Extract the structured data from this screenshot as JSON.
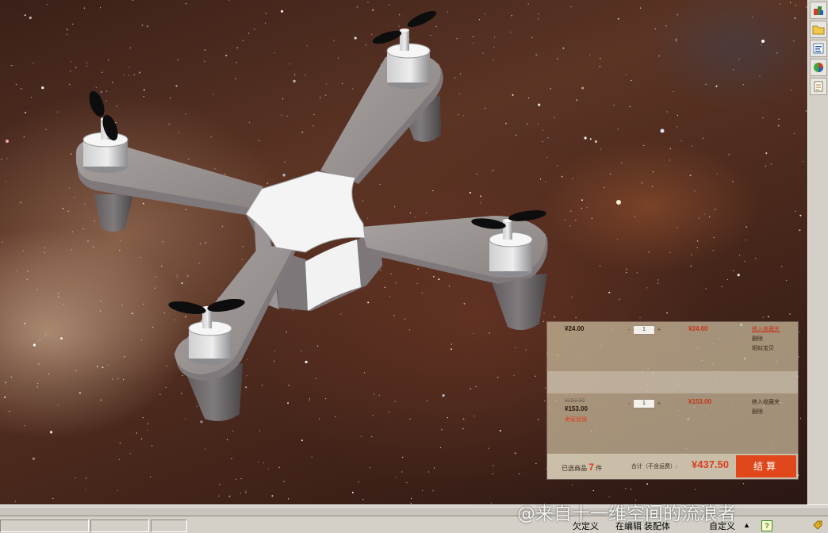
{
  "cart": {
    "items": [
      {
        "unit_price": "¥24.00",
        "quantity": "1",
        "subtotal": "¥24.00",
        "actions": [
          "移入收藏夹",
          "删除",
          "相似宝贝"
        ]
      },
      {
        "original_price": "¥153.00",
        "unit_price": "¥153.00",
        "quantity": "1",
        "subtotal": "¥153.00",
        "promo": "卖家促销",
        "actions": [
          "移入收藏夹",
          "删除"
        ]
      }
    ],
    "qty_minus": "-",
    "qty_plus": "+",
    "footer": {
      "selected_prefix": "已选商品",
      "selected_count": "7",
      "selected_suffix": "件",
      "total_label": "合计（不含运费）:",
      "total_value": "¥437.50",
      "checkout_label": "结算"
    }
  },
  "toolbar": {
    "buttons": [
      "view-3d-icon",
      "folder-icon",
      "properties-icon",
      "appearance-icon",
      "notes-icon"
    ]
  },
  "statusbar": {
    "left_text": "欠定义",
    "mid_text": "在编辑 装配体",
    "right_text": "自定义",
    "caret": "▲",
    "help": "?"
  },
  "watermark": "@来自十一维空间的流浪者"
}
